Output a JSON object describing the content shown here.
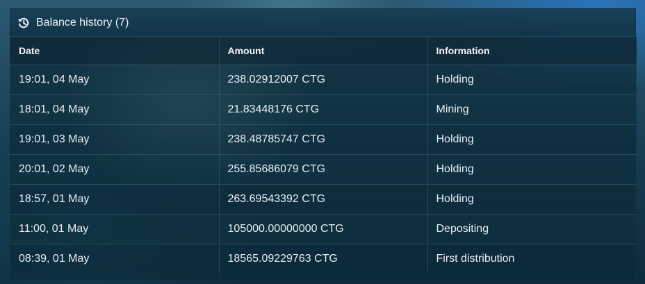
{
  "panel": {
    "title": "Balance history (7)",
    "icon": "history-icon"
  },
  "table": {
    "columns": [
      "Date",
      "Amount",
      "Information"
    ],
    "rows": [
      {
        "date": "19:01, 04 May",
        "amount": "238.02912007 CTG",
        "info": "Holding"
      },
      {
        "date": "18:01, 04 May",
        "amount": "21.83448176 CTG",
        "info": "Mining"
      },
      {
        "date": "19:01, 03 May",
        "amount": "238.48785747 CTG",
        "info": "Holding"
      },
      {
        "date": "20:01, 02 May",
        "amount": "255.85686079 CTG",
        "info": "Holding"
      },
      {
        "date": "18:57, 01 May",
        "amount": "263.69543392 CTG",
        "info": "Holding"
      },
      {
        "date": "11:00, 01 May",
        "amount": "105000.00000000 CTG",
        "info": "Depositing"
      },
      {
        "date": "08:39, 01 May",
        "amount": "18565.09229763 CTG",
        "info": "First distribution"
      }
    ]
  }
}
